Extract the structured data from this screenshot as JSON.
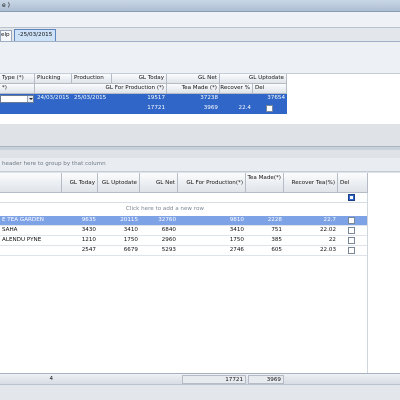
{
  "title_bar": {
    "title": "e )"
  },
  "tabs": [
    {
      "label": "elp"
    },
    {
      "label": "-25/03/2015"
    }
  ],
  "top_grid": {
    "headers_row1": [
      "Type (*)",
      "Plucking",
      "Production",
      "GL Today",
      "GL Net",
      "GL Uptodate"
    ],
    "headers_row2": [
      "*)",
      "GL For Production (*)",
      "Tea Made (*)",
      "Recover %",
      "Del"
    ],
    "row1": {
      "type": "",
      "plucking": "24/03/2015",
      "production": "25/03/2015",
      "gl_today": "19517",
      "gl_net": "37238",
      "gl_uptodate": "37654"
    },
    "row2": {
      "gl_for_production": "17721",
      "tea_made": "3969",
      "recover": "22.4",
      "del": false
    }
  },
  "group_panel": {
    "text": "header here to group by that column"
  },
  "bottom_grid": {
    "headers": [
      "",
      "GL Today",
      "GL Uptodate",
      "GL Net",
      "GL For Production(*)",
      "Tea Made(*)",
      "Recover Tea(%)",
      "Del"
    ],
    "new_row_text": "Click here to add a new row",
    "rows": [
      {
        "name": "E TEA GARDEN",
        "gl_today": "9635",
        "gl_uptodate": "20115",
        "gl_net": "32760",
        "gl_for_production": "9810",
        "tea_made": "2228",
        "recover": "22.7",
        "del": false
      },
      {
        "name": "SAHA",
        "gl_today": "3430",
        "gl_uptodate": "3410",
        "gl_net": "6840",
        "gl_for_production": "3410",
        "tea_made": "751",
        "recover": "22.02",
        "del": false
      },
      {
        "name": "ALENDU PYNE",
        "gl_today": "1210",
        "gl_uptodate": "1750",
        "gl_net": "2960",
        "gl_for_production": "1750",
        "tea_made": "385",
        "recover": "22",
        "del": false
      },
      {
        "name": "",
        "gl_today": "2547",
        "gl_uptodate": "6679",
        "gl_net": "5293",
        "gl_for_production": "2746",
        "tea_made": "605",
        "recover": "22.03",
        "del": false
      }
    ],
    "footer": {
      "count": "4",
      "gl_for_production": "17721",
      "tea_made": "3969"
    }
  },
  "colors": {
    "selection": "#2f66c7",
    "highlight_row": "#7ea2e6",
    "header_bg": "#e8ecf1",
    "tab_active": "#cde1f7"
  }
}
